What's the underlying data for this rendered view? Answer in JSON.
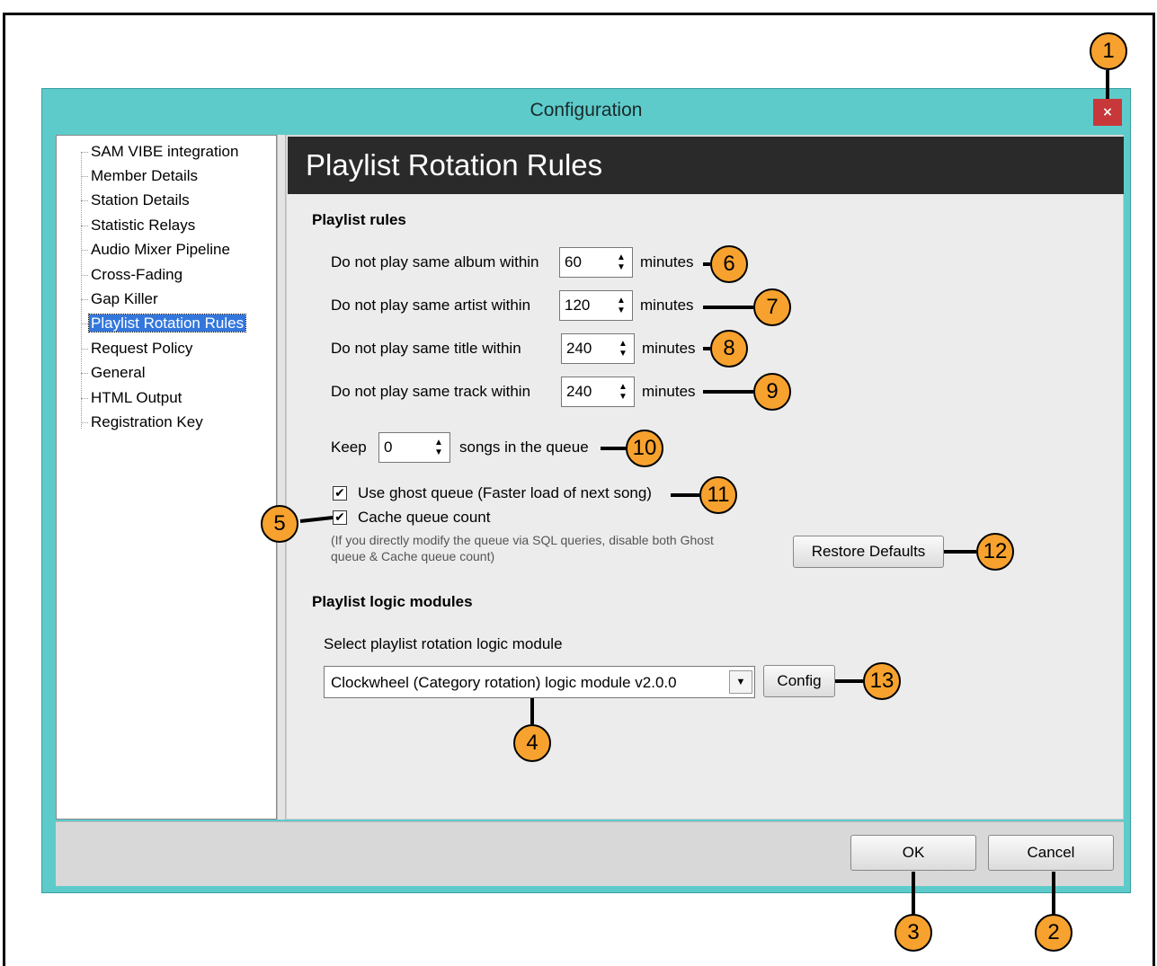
{
  "window": {
    "title": "Configuration",
    "close_label": "×"
  },
  "tree": {
    "items": [
      {
        "label": "SAM VIBE integration"
      },
      {
        "label": "Member Details"
      },
      {
        "label": "Station Details"
      },
      {
        "label": "Statistic Relays"
      },
      {
        "label": "Audio Mixer Pipeline"
      },
      {
        "label": "Cross-Fading"
      },
      {
        "label": "Gap Killer"
      },
      {
        "label": "Playlist Rotation Rules",
        "selected": true
      },
      {
        "label": "Request Policy"
      },
      {
        "label": "General"
      },
      {
        "label": "HTML Output"
      },
      {
        "label": "Registration Key"
      }
    ]
  },
  "page": {
    "header": "Playlist Rotation Rules",
    "rules_heading": "Playlist rules",
    "rules": [
      {
        "label": "Do not play same album within",
        "value": "60",
        "unit": "minutes"
      },
      {
        "label": "Do not play same artist within",
        "value": "120",
        "unit": "minutes"
      },
      {
        "label": "Do not play same title within",
        "value": "240",
        "unit": "minutes"
      },
      {
        "label": "Do not play same track within",
        "value": "240",
        "unit": "minutes"
      }
    ],
    "keep_label": "Keep",
    "keep_value": "0",
    "keep_suffix": "songs in the queue",
    "ghost_queue_label": "Use ghost queue (Faster load of next song)",
    "ghost_queue_checked": true,
    "cache_queue_label": "Cache queue count",
    "cache_queue_checked": true,
    "note": "(If you directly modify the queue via SQL queries, disable both Ghost queue & Cache queue count)",
    "restore_defaults": "Restore Defaults",
    "modules_heading": "Playlist logic modules",
    "modules_select_label": "Select playlist rotation logic module",
    "module_selected": "Clockwheel (Category rotation) logic module v2.0.0",
    "config_button": "Config",
    "check_mark": "✔"
  },
  "footer": {
    "ok": "OK",
    "cancel": "Cancel"
  },
  "callouts": [
    "1",
    "2",
    "3",
    "4",
    "5",
    "6",
    "7",
    "8",
    "9",
    "10",
    "11",
    "12",
    "13"
  ],
  "colors": {
    "titlebar": "#5ecbcb",
    "close": "#c7383b",
    "header": "#2a2a2a",
    "selection": "#3377dd",
    "badge": "#f7a22e"
  }
}
